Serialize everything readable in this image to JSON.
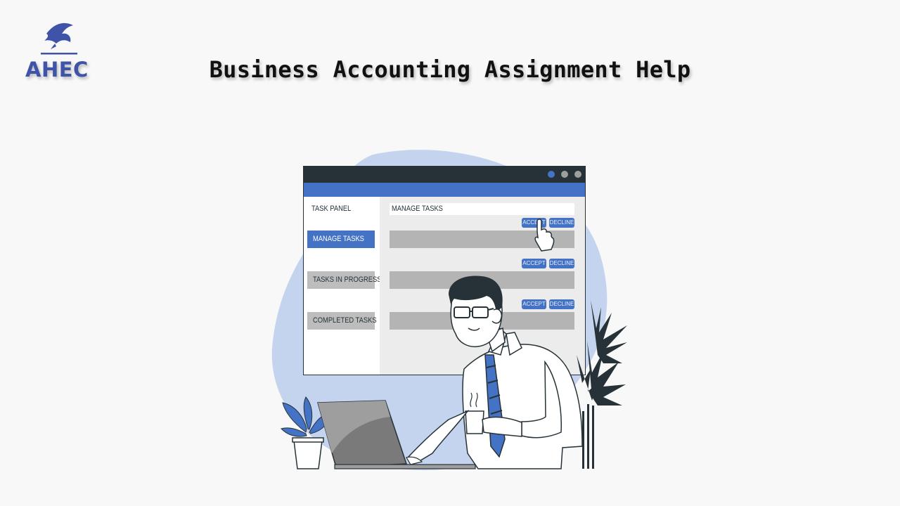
{
  "brand": {
    "logo_text": "AHEC",
    "accent_color": "#3f54a8"
  },
  "page": {
    "title": "Business Accounting Assignment Help"
  },
  "illustration": {
    "window": {
      "sidebar_title": "TASK PANEL",
      "nav_items": [
        {
          "label": "MANAGE TASKS",
          "active": true
        },
        {
          "label": "TASKS IN PROGRESS",
          "active": false
        },
        {
          "label": "COMPLETED TASKS",
          "active": false
        }
      ],
      "main_header": "MANAGE TASKS",
      "rows": [
        {
          "accept": "ACCEPT",
          "decline": "DECLINE"
        },
        {
          "accept": "ACCEPT",
          "decline": "DECLINE"
        },
        {
          "accept": "ACCEPT",
          "decline": "DECLINE"
        }
      ],
      "colors": {
        "titlebar": "#263238",
        "accent": "#4472c4",
        "blob": "#c5d4ee"
      }
    }
  }
}
